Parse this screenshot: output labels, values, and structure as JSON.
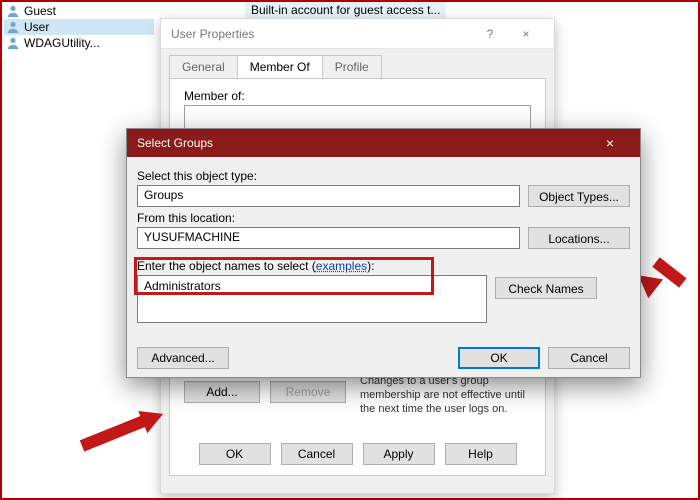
{
  "header_desc": "Built-in account for guest access t...",
  "users": [
    {
      "name": "Guest"
    },
    {
      "name": "User"
    },
    {
      "name": "WDAGUtility..."
    }
  ],
  "prop": {
    "title": "User Properties",
    "help": "?",
    "close": "×",
    "tabs": {
      "general": "General",
      "member_of": "Member Of",
      "profile": "Profile"
    },
    "member_label": "Member of:",
    "add": "Add...",
    "remove": "Remove",
    "note": "Changes to a user's group membership are not effective until the next time the user logs on.",
    "ok": "OK",
    "cancel": "Cancel",
    "apply": "Apply",
    "help_btn": "Help"
  },
  "sg": {
    "title": "Select Groups",
    "close": "×",
    "object_type_label": "Select this object type:",
    "object_type_value": "Groups",
    "object_types_btn": "Object Types...",
    "location_label": "From this location:",
    "location_value": "YUSUFMACHINE",
    "locations_btn": "Locations...",
    "enter_label_pre": "Enter the object names to select (",
    "enter_label_link": "examples",
    "enter_label_post": "):",
    "enter_value": "Administrators",
    "check_names": "Check Names",
    "advanced": "Advanced...",
    "ok": "OK",
    "cancel": "Cancel"
  }
}
